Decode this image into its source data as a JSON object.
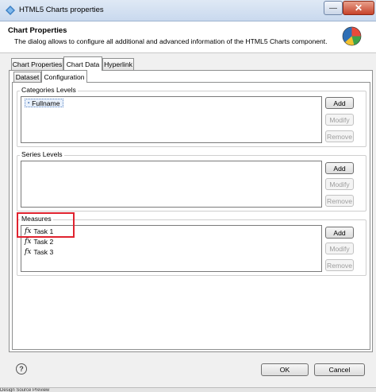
{
  "window": {
    "title": "HTML5 Charts properties",
    "close_glyph": "✕",
    "minimize_glyph": "—"
  },
  "header": {
    "title": "Chart Properties",
    "description": "The dialog allows to configure all additional and advanced information of the HTML5 Charts component."
  },
  "tabs": [
    "Chart Properties",
    "Chart Data",
    "Hyperlink"
  ],
  "subtabs": [
    "Dataset",
    "Configuration"
  ],
  "categories": {
    "label": "Categories Levels",
    "items": [
      "Fullname"
    ]
  },
  "series": {
    "label": "Series Levels",
    "items": []
  },
  "measures": {
    "label": "Measures",
    "items": [
      "Task 1",
      "Task 2",
      "Task 3"
    ]
  },
  "buttons": {
    "add": "Add",
    "modify": "Modify",
    "remove": "Remove",
    "ok": "OK",
    "cancel": "Cancel"
  },
  "icons": {
    "fx": "fx",
    "help": "?"
  },
  "statusbar": "Design  Source  Preview"
}
